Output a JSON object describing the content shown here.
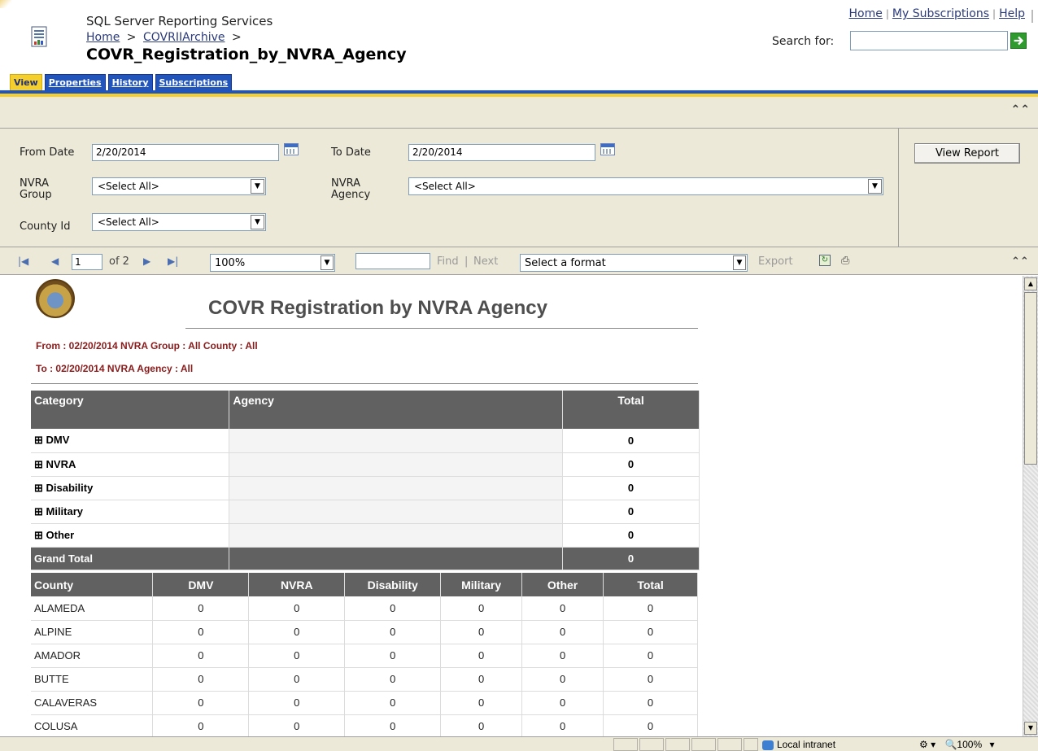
{
  "header": {
    "app_title": "SQL Server Reporting Services",
    "breadcrumb": {
      "home": "Home",
      "sep1": ">",
      "folder": "COVRIIArchive",
      "sep2": ">"
    },
    "report_title": "COVR_Registration_by_NVRA_Agency",
    "top_links": {
      "home": "Home",
      "subscriptions": "My Subscriptions",
      "help": "Help"
    },
    "search": {
      "label": "Search for:",
      "value": ""
    }
  },
  "tabs": [
    {
      "label": "View",
      "active": true
    },
    {
      "label": "Properties"
    },
    {
      "label": "History"
    },
    {
      "label": "Subscriptions"
    }
  ],
  "params": {
    "from_date": {
      "label": "From Date",
      "value": "2/20/2014"
    },
    "to_date": {
      "label": "To Date",
      "value": "2/20/2014"
    },
    "nvra_group": {
      "label_line1": "NVRA",
      "label_line2": "Group",
      "value": "<Select All>"
    },
    "nvra_agency": {
      "label_line1": "NVRA",
      "label_line2": "Agency",
      "value": "<Select All>"
    },
    "county_id": {
      "label": "County Id",
      "value": "<Select All>"
    },
    "view_report": "View Report"
  },
  "toolbar": {
    "page": "1",
    "of_pages": "of 2",
    "zoom": "100%",
    "find_text": "",
    "find": "Find",
    "sep": "|",
    "next": "Next",
    "format": "Select a format",
    "export": "Export"
  },
  "report": {
    "title": "COVR Registration by NVRA Agency",
    "sub1": "From : 02/20/2014 NVRA Group : All County : All",
    "sub2": "To : 02/20/2014 NVRA Agency : All",
    "summary": {
      "headers": [
        "Category",
        "Agency",
        "Total"
      ],
      "rows": [
        {
          "category": "⊞ DMV",
          "agency": "",
          "total": "0"
        },
        {
          "category": "⊞ NVRA",
          "agency": "",
          "total": "0"
        },
        {
          "category": "⊞ Disability",
          "agency": "",
          "total": "0"
        },
        {
          "category": "⊞ Military",
          "agency": "",
          "total": "0"
        },
        {
          "category": "⊞ Other",
          "agency": "",
          "total": "0"
        }
      ],
      "grand_total": {
        "label": "Grand Total",
        "total": "0"
      }
    },
    "county_table": {
      "headers": [
        "County",
        "DMV",
        "NVRA",
        "Disability",
        "Military",
        "Other",
        "Total"
      ],
      "rows": [
        [
          "ALAMEDA",
          "0",
          "0",
          "0",
          "0",
          "0",
          "0"
        ],
        [
          "ALPINE",
          "0",
          "0",
          "0",
          "0",
          "0",
          "0"
        ],
        [
          "AMADOR",
          "0",
          "0",
          "0",
          "0",
          "0",
          "0"
        ],
        [
          "BUTTE",
          "0",
          "0",
          "0",
          "0",
          "0",
          "0"
        ],
        [
          "CALAVERAS",
          "0",
          "0",
          "0",
          "0",
          "0",
          "0"
        ],
        [
          "COLUSA",
          "0",
          "0",
          "0",
          "0",
          "0",
          "0"
        ]
      ]
    }
  },
  "statusbar": {
    "zone": "Local intranet",
    "zoom": "100%"
  },
  "colors": {
    "tab_blue": "#2255bb",
    "tab_yellow": "#f5cf2c",
    "table_header": "#616161",
    "subtitle_red": "#8b1a1a"
  }
}
